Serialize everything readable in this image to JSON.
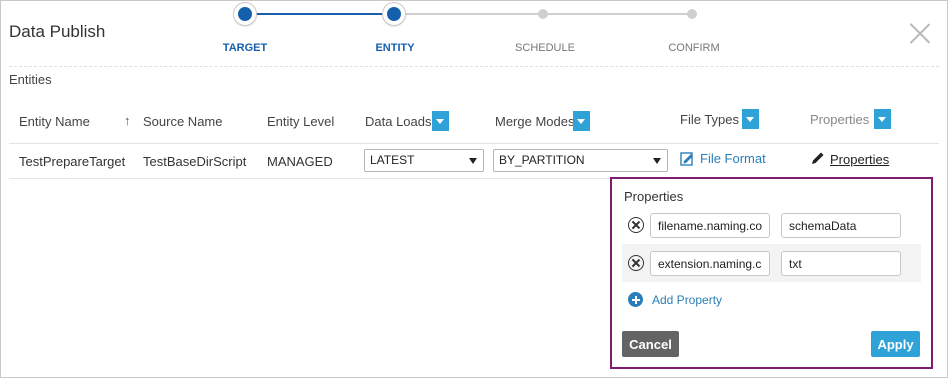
{
  "dialog": {
    "title": "Data Publish"
  },
  "stepper": {
    "steps": [
      {
        "label": "TARGET",
        "state": "done"
      },
      {
        "label": "ENTITY",
        "state": "current"
      },
      {
        "label": "SCHEDULE",
        "state": "pending"
      },
      {
        "label": "CONFIRM",
        "state": "pending"
      }
    ]
  },
  "section": {
    "label": "Entities"
  },
  "table": {
    "columns": {
      "entity_name": "Entity Name",
      "source_name": "Source Name",
      "entity_level": "Entity Level",
      "data_loads": "Data Loads",
      "merge_modes": "Merge Modes",
      "file_types": "File Types",
      "properties": "Properties"
    },
    "sort_icon": "arrow-up-icon",
    "rows": [
      {
        "entity_name": "TestPrepareTarget",
        "source_name": "TestBaseDirScript",
        "entity_level": "MANAGED",
        "data_load": "LATEST",
        "merge_mode": "BY_PARTITION",
        "file_format_link": "File Format",
        "properties_link": "Properties"
      }
    ]
  },
  "properties_popover": {
    "title": "Properties",
    "items": [
      {
        "key": "filename.naming.co",
        "value": "schemaData"
      },
      {
        "key": "extension.naming.c",
        "value": "txt"
      }
    ],
    "add_label": "Add Property",
    "cancel_label": "Cancel",
    "apply_label": "Apply"
  },
  "colors": {
    "accent": "#1560ad",
    "filter_button": "#2fa3d8",
    "link": "#2a7fba",
    "popover_border": "#7c1d6f",
    "cancel_button": "#646464",
    "apply_button": "#2fa3d8"
  }
}
